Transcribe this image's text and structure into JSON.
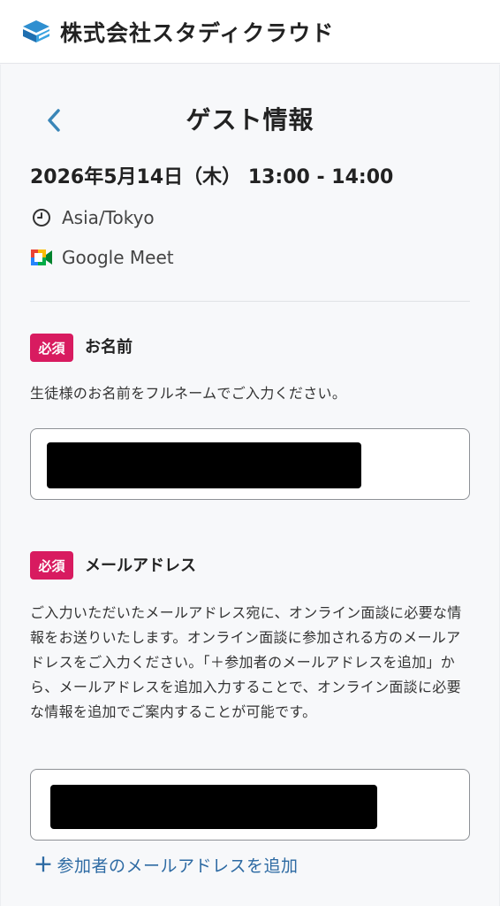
{
  "header": {
    "company_name": "株式会社スタディクラウド"
  },
  "page": {
    "title": "ゲスト情報",
    "datetime": "2026年5月14日（木） 13:00 - 14:00",
    "timezone": "Asia/Tokyo",
    "meeting_tool": "Google Meet"
  },
  "name_field": {
    "required_badge": "必須",
    "label": "お名前",
    "help": "生徒様のお名前をフルネームでご入力ください。",
    "value_redacted": true
  },
  "email_field": {
    "required_badge": "必須",
    "label": "メールアドレス",
    "help": "ご入力いただいたメールアドレス宛に、オンライン面談に必要な情報をお送りいたします。オンライン面談に参加される方のメールアドレスをご入力ください。「＋参加者のメールアドレスを追加」から、メールアドレスを追加入力することで、オンライン面談に必要な情報を追加でご案内することが可能です。",
    "value_redacted": true
  },
  "add_participant_link": "参加者のメールアドレスを追加",
  "colors": {
    "accent": "#2d6aa3",
    "required_badge": "#d81b60",
    "back_arrow": "#3a86b8"
  },
  "icons": {
    "logo": "company-logo",
    "back": "chevron-left-icon",
    "timezone": "clock-icon",
    "meeting": "google-meet-icon",
    "add": "plus-icon"
  }
}
